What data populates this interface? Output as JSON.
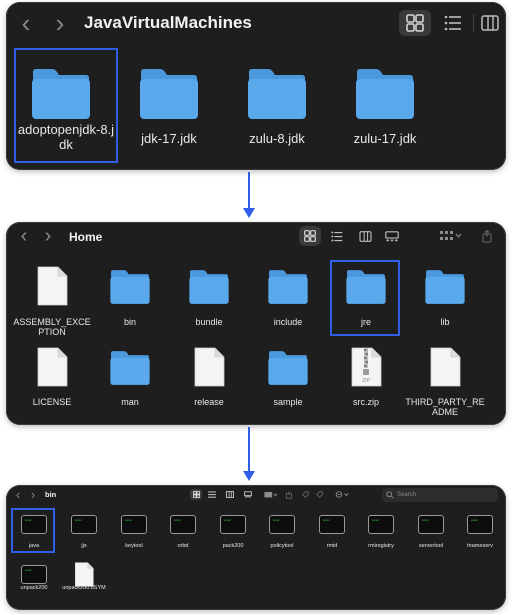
{
  "window1": {
    "title": "JavaVirtualMachines",
    "nav_back": "‹",
    "nav_forward": "›",
    "items": [
      {
        "label": "adoptopenjdk-8.jdk",
        "label_lines": [
          "adoptopenjdk-8.j",
          "dk"
        ],
        "selected": true
      },
      {
        "label": "jdk-17.jdk",
        "label_lines": [
          "jdk-17.jdk"
        ],
        "selected": false
      },
      {
        "label": "zulu-8.jdk",
        "label_lines": [
          "zulu-8.jdk"
        ],
        "selected": false
      },
      {
        "label": "zulu-17.jdk",
        "label_lines": [
          "zulu-17.jdk"
        ],
        "selected": false
      }
    ]
  },
  "window2": {
    "title": "Home",
    "nav_back": "‹",
    "nav_forward": "›",
    "items": [
      {
        "label_lines": [
          "ASSEMBLY_EXCE",
          "PTION"
        ],
        "kind": "file"
      },
      {
        "label_lines": [
          "bin"
        ],
        "kind": "folder"
      },
      {
        "label_lines": [
          "bundle"
        ],
        "kind": "folder"
      },
      {
        "label_lines": [
          "include"
        ],
        "kind": "folder"
      },
      {
        "label_lines": [
          "jre"
        ],
        "kind": "folder",
        "selected": true
      },
      {
        "label_lines": [
          "lib"
        ],
        "kind": "folder"
      },
      {
        "label_lines": [
          "LICENSE"
        ],
        "kind": "file"
      },
      {
        "label_lines": [
          "man"
        ],
        "kind": "folder"
      },
      {
        "label_lines": [
          "release"
        ],
        "kind": "file"
      },
      {
        "label_lines": [
          "sample"
        ],
        "kind": "folder"
      },
      {
        "label_lines": [
          "src.zip"
        ],
        "kind": "zip",
        "badge": "ZIP"
      },
      {
        "label_lines": [
          "THIRD_PARTY_RE",
          "ADME"
        ],
        "kind": "file"
      }
    ]
  },
  "window3": {
    "title": "bin",
    "nav_back": "‹",
    "nav_forward": "›",
    "search_placeholder": "Search",
    "exec_text": "exec",
    "items": [
      {
        "label": "java",
        "kind": "exec",
        "selected": true
      },
      {
        "label": "jjs",
        "kind": "exec"
      },
      {
        "label": "keytool",
        "kind": "exec"
      },
      {
        "label": "orbd",
        "kind": "exec"
      },
      {
        "label": "pack200",
        "kind": "exec"
      },
      {
        "label": "policytool",
        "kind": "exec"
      },
      {
        "label": "rmid",
        "kind": "exec"
      },
      {
        "label": "rmiregistry",
        "kind": "exec"
      },
      {
        "label": "servertool",
        "kind": "exec"
      },
      {
        "label": "tnameserv",
        "kind": "exec"
      },
      {
        "label": "unpack200",
        "kind": "exec"
      },
      {
        "label": "unpack200.dSYM",
        "kind": "file"
      }
    ]
  },
  "colors": {
    "window_bg": "#1e1e1e",
    "folder_body": "#5aa9ec",
    "folder_tab": "#4b98dd",
    "selection": "#2f5ee8",
    "arrow": "#2f5ee8"
  }
}
